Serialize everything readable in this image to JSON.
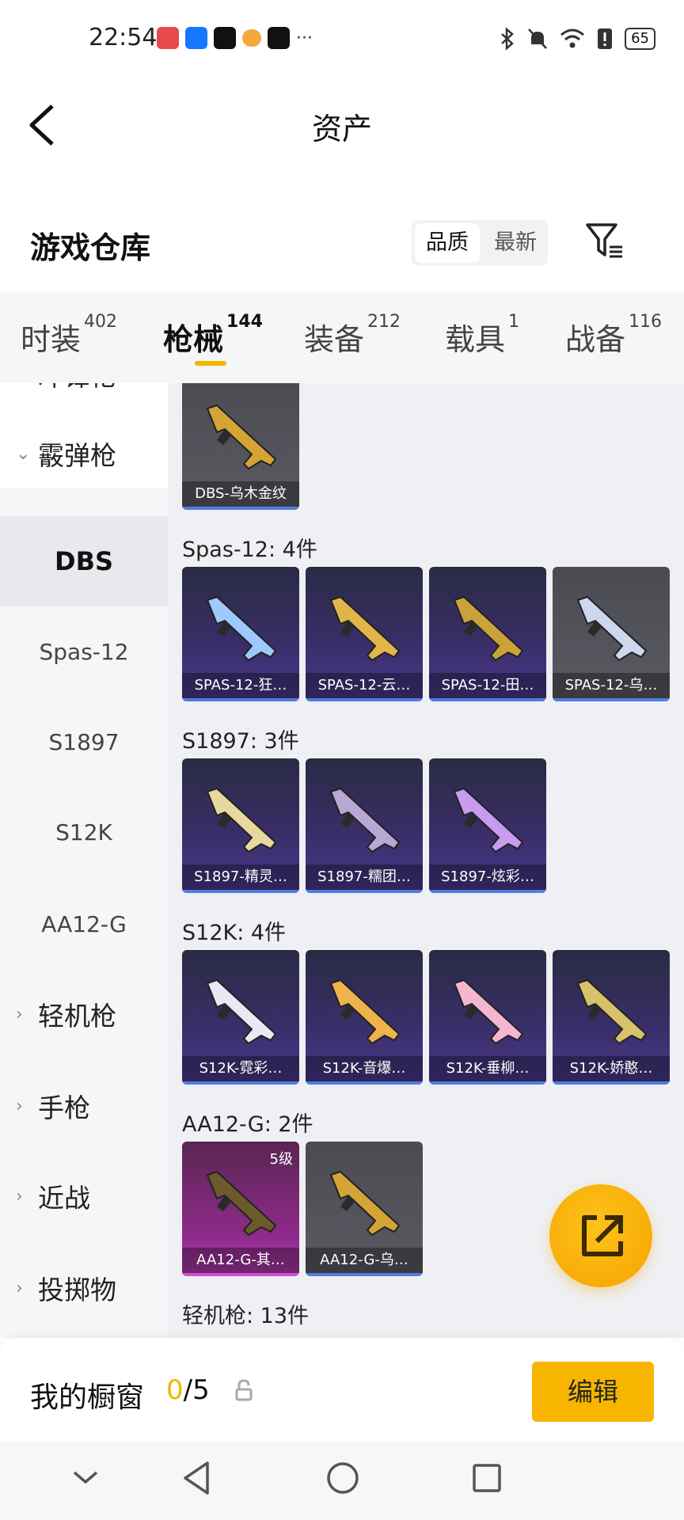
{
  "status_bar": {
    "time": "22:54",
    "battery": "65"
  },
  "header": {
    "title": "资产"
  },
  "warehouse": {
    "title": "游戏仓库",
    "sort_options": [
      "品质",
      "最新"
    ]
  },
  "tabs": [
    {
      "label": "时装",
      "count": "402"
    },
    {
      "label": "枪械",
      "count": "144"
    },
    {
      "label": "装备",
      "count": "212"
    },
    {
      "label": "载具",
      "count": "1"
    },
    {
      "label": "战备",
      "count": "116"
    }
  ],
  "sidebar": {
    "cut_item": "冲锋枪",
    "items": [
      {
        "label": "霰弹枪",
        "expanded": true
      },
      {
        "label": "DBS"
      },
      {
        "label": "Spas-12"
      },
      {
        "label": "S1897"
      },
      {
        "label": "S12K"
      },
      {
        "label": "AA12-G"
      },
      {
        "label": "轻机枪"
      },
      {
        "label": "手枪"
      },
      {
        "label": "近战"
      },
      {
        "label": "投掷物"
      }
    ]
  },
  "groups": [
    {
      "label": "",
      "items": [
        {
          "name": "DBS-乌木金纹",
          "style": "gray"
        }
      ]
    },
    {
      "label": "Spas-12: 4件",
      "items": [
        {
          "name": "SPAS-12-狂…",
          "style": "purple"
        },
        {
          "name": "SPAS-12-云…",
          "style": "purple"
        },
        {
          "name": "SPAS-12-田…",
          "style": "purple"
        },
        {
          "name": "SPAS-12-乌…",
          "style": "gray"
        }
      ]
    },
    {
      "label": "S1897: 3件",
      "items": [
        {
          "name": "S1897-精灵…",
          "style": "purple"
        },
        {
          "name": "S1897-糯团…",
          "style": "purple"
        },
        {
          "name": "S1897-炫彩…",
          "style": "purple"
        }
      ]
    },
    {
      "label": "S12K: 4件",
      "items": [
        {
          "name": "S12K-霓彩…",
          "style": "purple"
        },
        {
          "name": "S12K-音爆…",
          "style": "purple"
        },
        {
          "name": "S12K-垂柳…",
          "style": "purple"
        },
        {
          "name": "S12K-娇憨…",
          "style": "purple"
        }
      ]
    },
    {
      "label": "AA12-G: 2件",
      "items": [
        {
          "name": "AA12-G-其…",
          "style": "pink",
          "level": "5级"
        },
        {
          "name": "AA12-G-乌…",
          "style": "gray"
        }
      ]
    },
    {
      "label": "轻机枪: 13件",
      "items": []
    }
  ],
  "showcase": {
    "label": "我的橱窗",
    "current": "0",
    "total": "/5",
    "edit_label": "编辑"
  },
  "colors": {
    "accent": "#f5b400",
    "card_purple": "#3a2f6a",
    "card_gray": "#55565c",
    "card_pink": "#9b2f98"
  }
}
